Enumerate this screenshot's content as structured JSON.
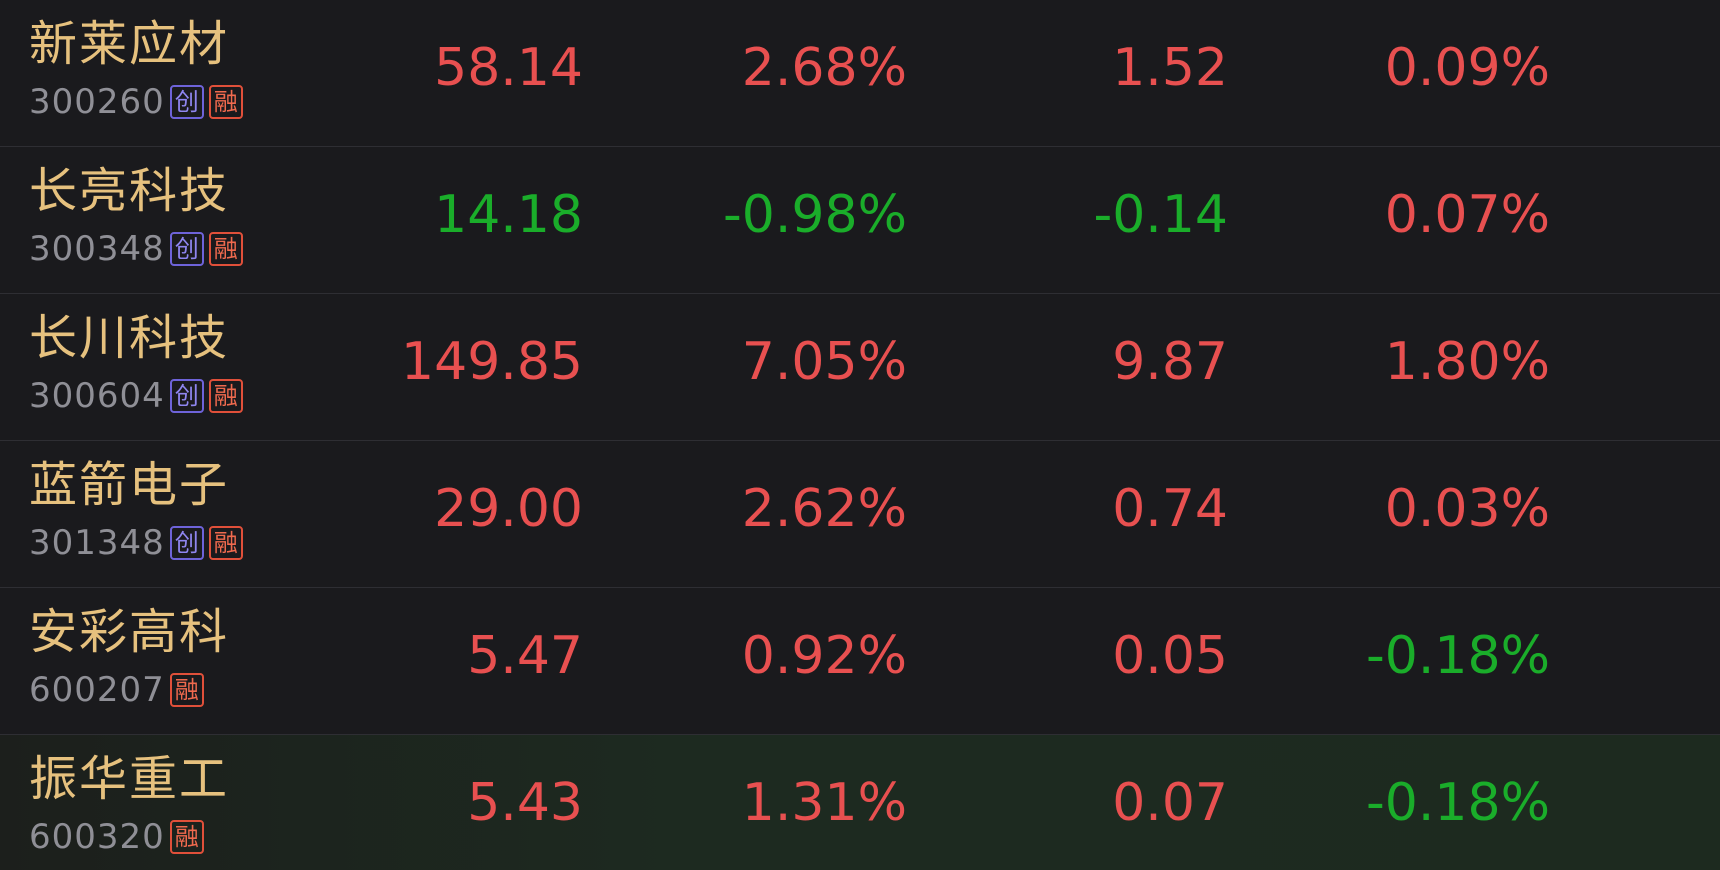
{
  "colors": {
    "background": "#1a1a1d",
    "name": "#e6c17e",
    "code": "#8f8f96",
    "up": "#e85050",
    "down": "#1aad2a",
    "tag_chuang": "#6e63d9",
    "tag_rong": "#e0503a"
  },
  "tags": {
    "chuang": "创",
    "rong": "融"
  },
  "rows": [
    {
      "name": "新莱应材",
      "code": "300260",
      "chuang": true,
      "rong": true,
      "price": "58.14",
      "change_pct": "2.68%",
      "change": "1.52",
      "speed": "0.09%",
      "price_dir": "up",
      "pct_dir": "up",
      "chg_dir": "up",
      "speed_dir": "up"
    },
    {
      "name": "长亮科技",
      "code": "300348",
      "chuang": true,
      "rong": true,
      "price": "14.18",
      "change_pct": "-0.98%",
      "change": "-0.14",
      "speed": "0.07%",
      "price_dir": "down",
      "pct_dir": "down",
      "chg_dir": "down",
      "speed_dir": "up"
    },
    {
      "name": "长川科技",
      "code": "300604",
      "chuang": true,
      "rong": true,
      "price": "149.85",
      "change_pct": "7.05%",
      "change": "9.87",
      "speed": "1.80%",
      "price_dir": "up",
      "pct_dir": "up",
      "chg_dir": "up",
      "speed_dir": "up"
    },
    {
      "name": "蓝箭电子",
      "code": "301348",
      "chuang": true,
      "rong": true,
      "price": "29.00",
      "change_pct": "2.62%",
      "change": "0.74",
      "speed": "0.03%",
      "price_dir": "up",
      "pct_dir": "up",
      "chg_dir": "up",
      "speed_dir": "up"
    },
    {
      "name": "安彩高科",
      "code": "600207",
      "chuang": false,
      "rong": true,
      "price": "5.47",
      "change_pct": "0.92%",
      "change": "0.05",
      "speed": "-0.18%",
      "price_dir": "up",
      "pct_dir": "up",
      "chg_dir": "up",
      "speed_dir": "down"
    },
    {
      "name": "振华重工",
      "code": "600320",
      "chuang": false,
      "rong": true,
      "price": "5.43",
      "change_pct": "1.31%",
      "change": "0.07",
      "speed": "-0.18%",
      "price_dir": "up",
      "pct_dir": "up",
      "chg_dir": "up",
      "speed_dir": "down",
      "highlight": true
    }
  ]
}
